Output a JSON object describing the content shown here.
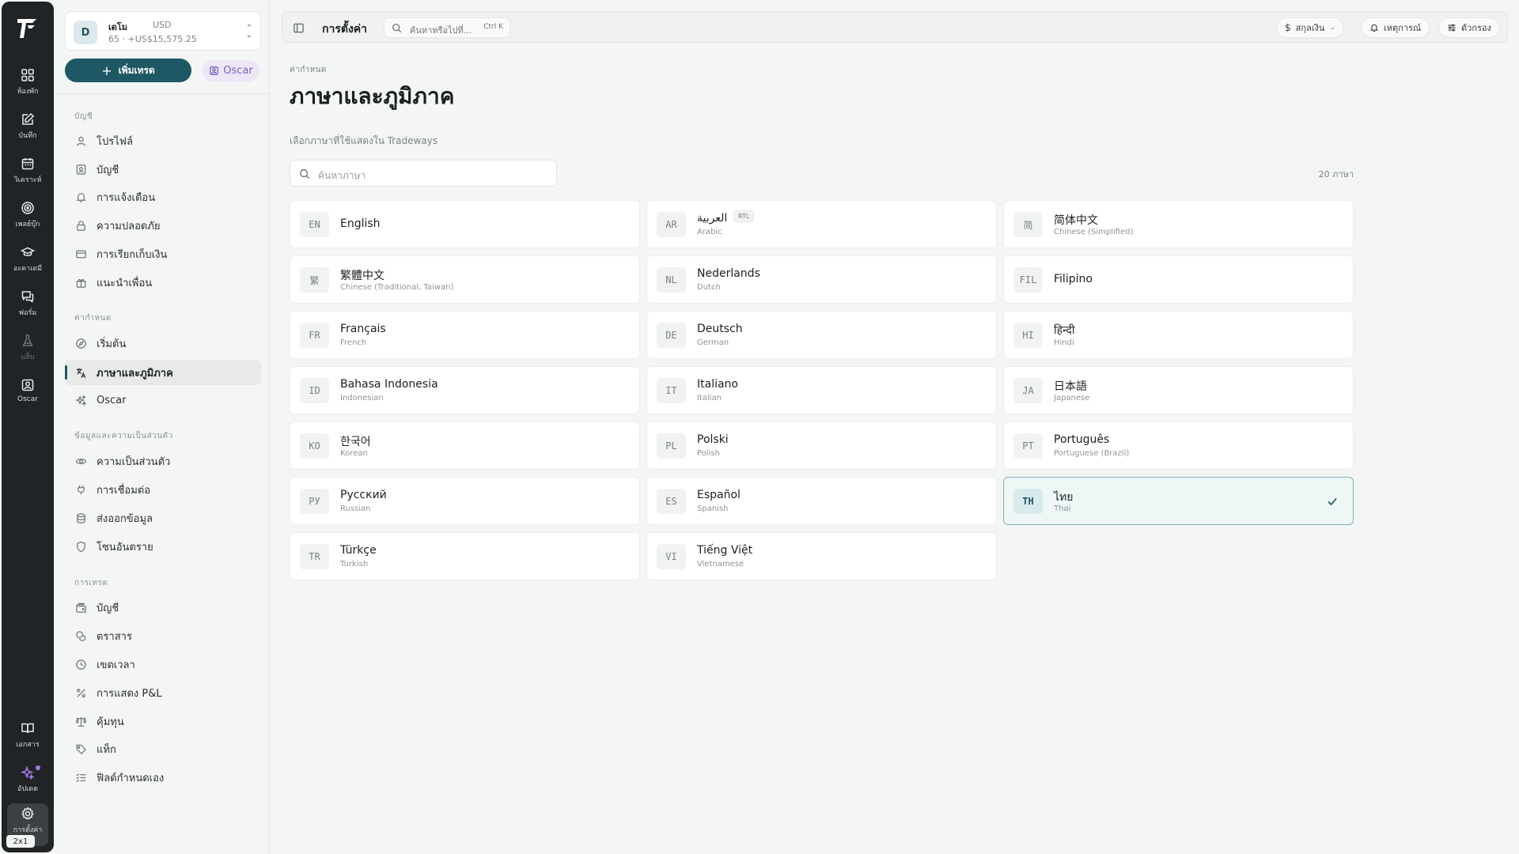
{
  "rail": {
    "items": [
      {
        "label": "ห้องพัก",
        "icon": "dashboard-grid-icon"
      },
      {
        "label": "บันทึก",
        "icon": "journal-edit-icon"
      },
      {
        "label": "วิเคราะห์",
        "icon": "calendar-icon"
      },
      {
        "label": "เพลย์บุ๊ก",
        "icon": "target-icon"
      },
      {
        "label": "อะคาเดมี",
        "icon": "graduation-cap-icon"
      },
      {
        "label": "ฟอรั่ม",
        "icon": "chat-icon"
      },
      {
        "label": "แล็บ",
        "icon": "flask-icon"
      },
      {
        "label": "Oscar",
        "icon": "oscar-portrait-icon"
      }
    ],
    "bottom": [
      {
        "label": "เอกสาร",
        "icon": "book-icon"
      },
      {
        "label": "อัปเดต",
        "icon": "sparkle-icon"
      },
      {
        "label": "การตั้งค่า",
        "icon": "gear-icon"
      }
    ],
    "badge": "2x1"
  },
  "account": {
    "avatar": "D",
    "name": "เดโม",
    "currency": "USD",
    "balance": "65 · +US$15,575.25"
  },
  "sidebar": {
    "add_trade": "เพิ่มเทรด",
    "oscar": "Oscar",
    "sections": [
      {
        "title": "บัญชี",
        "items": [
          {
            "label": "โปรไฟล์",
            "icon": "user-icon"
          },
          {
            "label": "บัญชี",
            "icon": "id-card-icon"
          },
          {
            "label": "การแจ้งเตือน",
            "icon": "bell-icon"
          },
          {
            "label": "ความปลอดภัย",
            "icon": "lock-icon"
          },
          {
            "label": "การเรียกเก็บเงิน",
            "icon": "credit-card-icon"
          },
          {
            "label": "แนะนำเพื่อน",
            "icon": "gift-icon"
          }
        ]
      },
      {
        "title": "ค่ากำหนด",
        "items": [
          {
            "label": "เริ่มต้น",
            "icon": "compass-icon"
          },
          {
            "label": "ภาษาและภูมิภาค",
            "icon": "translate-icon"
          },
          {
            "label": "Oscar",
            "icon": "sparkles-icon"
          }
        ]
      },
      {
        "title": "ข้อมูลและความเป็นส่วนตัว",
        "items": [
          {
            "label": "ความเป็นส่วนตัว",
            "icon": "eye-icon"
          },
          {
            "label": "การเชื่อมต่อ",
            "icon": "plug-icon"
          },
          {
            "label": "ส่งออกข้อมูล",
            "icon": "database-icon"
          },
          {
            "label": "โซนอันตราย",
            "icon": "shield-icon"
          }
        ]
      },
      {
        "title": "การเทรด",
        "items": [
          {
            "label": "บัญชี",
            "icon": "wallet-icon"
          },
          {
            "label": "ตราสาร",
            "icon": "coins-icon"
          },
          {
            "label": "เขตเวลา",
            "icon": "clock-icon"
          },
          {
            "label": "การแสดง P&L",
            "icon": "percent-icon"
          },
          {
            "label": "คุ้มทุน",
            "icon": "scale-icon"
          },
          {
            "label": "แท็ก",
            "icon": "tag-icon"
          },
          {
            "label": "ฟิลด์กำหนดเอง",
            "icon": "list-check-icon"
          }
        ]
      }
    ]
  },
  "topbar": {
    "title": "การตั้งค่า",
    "search_placeholder": "ค้นหาหรือไปที่...",
    "search_kbd": "Ctrl K",
    "currency": "สกุลเงิน",
    "events": "เหตุการณ์",
    "filters": "ตัวกรอง"
  },
  "page": {
    "crumb": "ค่ากำหนด",
    "title": "ภาษาและภูมิภาค",
    "description": "เลือกภาษาที่ใช้แสดงใน Tradeways",
    "search_placeholder": "ค้นหาภาษา",
    "count": "20 ภาษา"
  },
  "languages": [
    {
      "code": "EN",
      "native": "English",
      "english": "",
      "rtl": "",
      "selected": false
    },
    {
      "code": "AR",
      "native": "العربية",
      "english": "Arabic",
      "rtl": "RTL",
      "selected": false
    },
    {
      "code": "简",
      "native": "简体中文",
      "english": "Chinese (Simplified)",
      "rtl": "",
      "selected": false
    },
    {
      "code": "繁",
      "native": "繁體中文",
      "english": "Chinese (Traditional, Taiwan)",
      "rtl": "",
      "selected": false
    },
    {
      "code": "NL",
      "native": "Nederlands",
      "english": "Dutch",
      "rtl": "",
      "selected": false
    },
    {
      "code": "FIL",
      "native": "Filipino",
      "english": "",
      "rtl": "",
      "selected": false
    },
    {
      "code": "FR",
      "native": "Français",
      "english": "French",
      "rtl": "",
      "selected": false
    },
    {
      "code": "DE",
      "native": "Deutsch",
      "english": "German",
      "rtl": "",
      "selected": false
    },
    {
      "code": "HI",
      "native": "हिन्दी",
      "english": "Hindi",
      "rtl": "",
      "selected": false
    },
    {
      "code": "ID",
      "native": "Bahasa Indonesia",
      "english": "Indonesian",
      "rtl": "",
      "selected": false
    },
    {
      "code": "IT",
      "native": "Italiano",
      "english": "Italian",
      "rtl": "",
      "selected": false
    },
    {
      "code": "JA",
      "native": "日本語",
      "english": "Japanese",
      "rtl": "",
      "selected": false
    },
    {
      "code": "KO",
      "native": "한국어",
      "english": "Korean",
      "rtl": "",
      "selected": false
    },
    {
      "code": "PL",
      "native": "Polski",
      "english": "Polish",
      "rtl": "",
      "selected": false
    },
    {
      "code": "PT",
      "native": "Português",
      "english": "Portuguese (Brazil)",
      "rtl": "",
      "selected": false
    },
    {
      "code": "РУ",
      "native": "Русский",
      "english": "Russian",
      "rtl": "",
      "selected": false
    },
    {
      "code": "ES",
      "native": "Español",
      "english": "Spanish",
      "rtl": "",
      "selected": false
    },
    {
      "code": "TH",
      "native": "ไทย",
      "english": "Thai",
      "rtl": "",
      "selected": true
    },
    {
      "code": "TR",
      "native": "Türkçe",
      "english": "Turkish",
      "rtl": "",
      "selected": false
    },
    {
      "code": "VI",
      "native": "Tiếng Việt",
      "english": "Vietnamese",
      "rtl": "",
      "selected": false
    }
  ],
  "colors": {
    "accent": "#1d5864",
    "oscar": "#8060c4",
    "rail": "#202426"
  }
}
